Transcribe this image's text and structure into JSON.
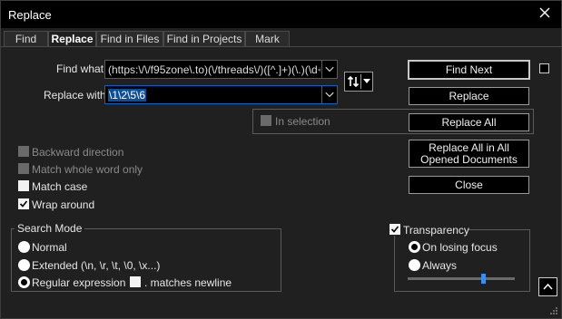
{
  "window": {
    "title": "Replace"
  },
  "tabs": [
    {
      "label": "Find"
    },
    {
      "label": "Replace"
    },
    {
      "label": "Find in Files"
    },
    {
      "label": "Find in Projects"
    },
    {
      "label": "Mark"
    }
  ],
  "fields": {
    "find_label": "Find what:",
    "find_value": "(https:\\/\\/f95zone\\.to)(\\/threads\\/)([^.]+)(\\.)(\\d+)",
    "replace_label": "Replace with:",
    "replace_value": "\\1\\2\\5\\6"
  },
  "buttons": {
    "find_next": "Find Next",
    "replace": "Replace",
    "replace_all": "Replace All",
    "replace_all_opened": "Replace All in All Opened Documents",
    "close": "Close"
  },
  "options": {
    "in_selection": "In selection",
    "backward_direction": "Backward direction",
    "match_whole_word": "Match whole word only",
    "match_case": "Match case",
    "wrap_around": "Wrap around"
  },
  "search_mode": {
    "title": "Search Mode",
    "normal": "Normal",
    "extended": "Extended (\\n, \\r, \\t, \\0, \\x...)",
    "regex": "Regular expression",
    "matches_newline": ". matches newline"
  },
  "transparency": {
    "title": "Transparency",
    "on_losing_focus": "On losing focus",
    "always": "Always",
    "level": 0.72
  },
  "colors": {
    "accent": "#0a4f9c",
    "slider": "#3a8ee6"
  }
}
